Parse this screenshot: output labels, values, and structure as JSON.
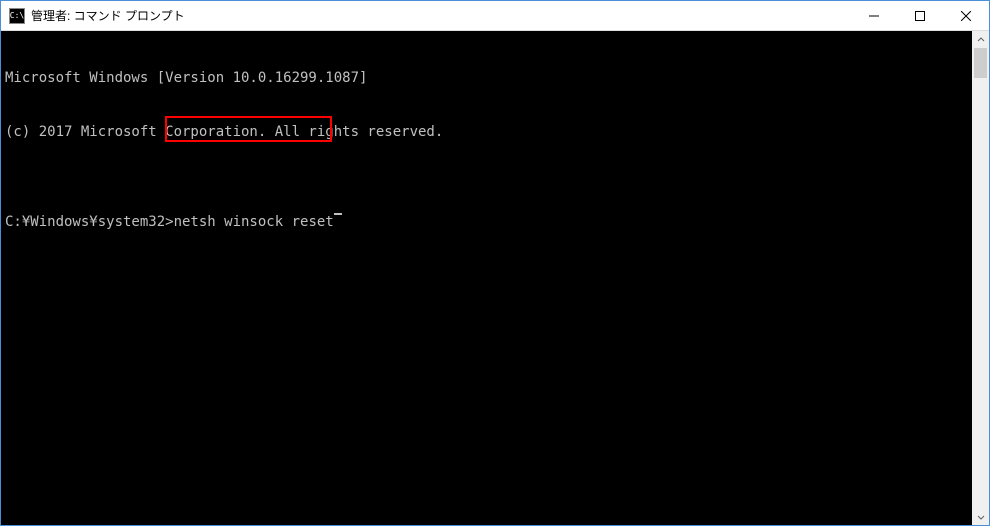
{
  "window": {
    "icon_label": "C:\\",
    "title": "管理者: コマンド プロンプト"
  },
  "terminal": {
    "line1": "Microsoft Windows [Version 10.0.16299.1087]",
    "line2": "(c) 2017 Microsoft Corporation. All rights reserved.",
    "blank": "",
    "prompt": "C:¥Windows¥system32>",
    "command": "netsh winsock reset"
  },
  "highlight": {
    "color": "#ff0000"
  }
}
